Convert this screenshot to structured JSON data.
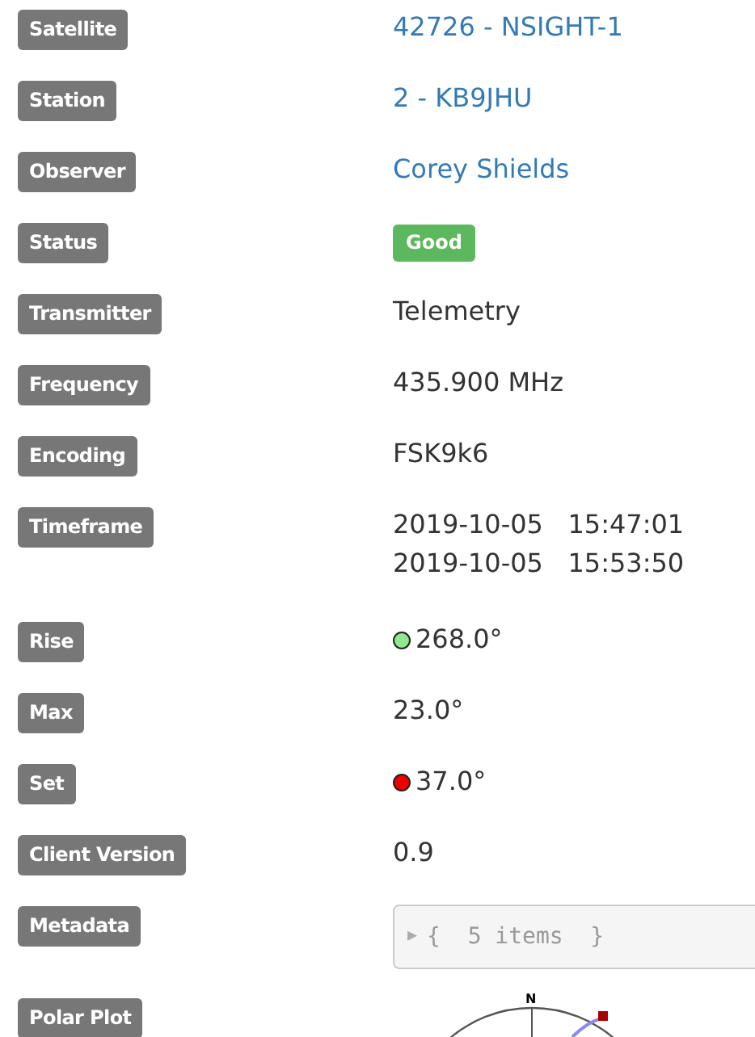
{
  "rows": [
    {
      "label": "Satellite",
      "kind": "link",
      "value": "42726 - NSIGHT-1"
    },
    {
      "label": "Station",
      "kind": "link",
      "value": "2 - KB9JHU"
    },
    {
      "label": "Observer",
      "kind": "link",
      "value": "Corey Shields"
    },
    {
      "label": "Status",
      "kind": "badge",
      "value": "Good",
      "color": "#5cb85c"
    },
    {
      "label": "Transmitter",
      "kind": "text",
      "value": "Telemetry"
    },
    {
      "label": "Frequency",
      "kind": "text",
      "value": "435.900 MHz"
    },
    {
      "label": "Encoding",
      "kind": "text",
      "value": "FSK9k6"
    },
    {
      "label": "Timeframe",
      "kind": "lines",
      "lines": [
        "2019-10-05   15:47:01",
        "2019-10-05   15:53:50"
      ]
    },
    {
      "label": "Rise",
      "kind": "dot",
      "value": "268.0°",
      "color": "#90e890"
    },
    {
      "label": "Max",
      "kind": "text",
      "value": "23.0°"
    },
    {
      "label": "Set",
      "kind": "dot",
      "value": "37.0°",
      "color": "#ee0000"
    },
    {
      "label": "Client Version",
      "kind": "text",
      "value": "0.9"
    },
    {
      "label": "Metadata",
      "kind": "code",
      "arrow": "▶",
      "value": "{  5 items  }"
    },
    {
      "label": "Polar Plot",
      "kind": "plot",
      "north": "N"
    }
  ]
}
